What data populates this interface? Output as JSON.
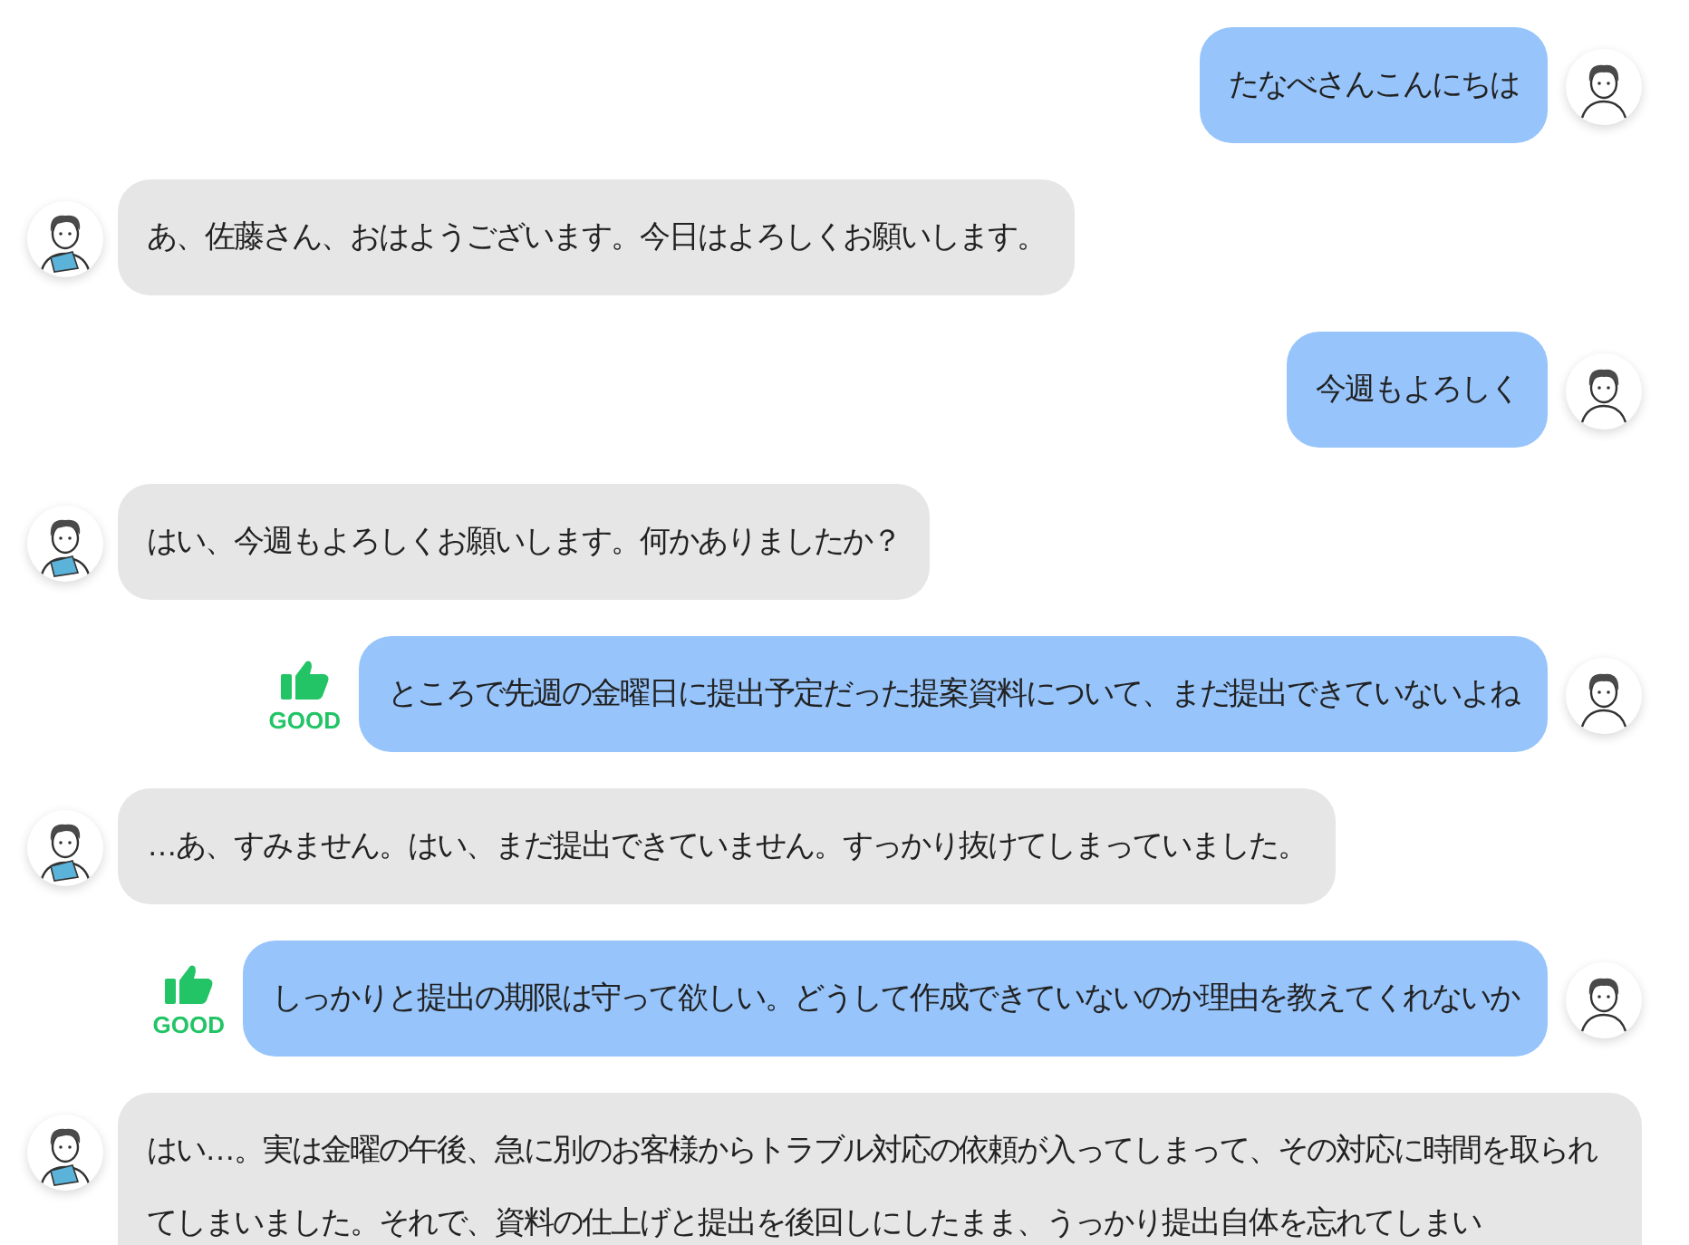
{
  "messages": [
    {
      "kind": "user",
      "text": "たなべさんこんにちは"
    },
    {
      "kind": "partner",
      "text": "あ、佐藤さん、おはようございます。今日はよろしくお願いします。"
    },
    {
      "kind": "user",
      "text": "今週もよろしく"
    },
    {
      "kind": "partner",
      "text": "はい、今週もよろしくお願いします。何かありましたか？"
    },
    {
      "kind": "user",
      "text": "ところで先週の金曜日に提出予定だった提案資料について、まだ提出できていないよね",
      "badge": "GOOD"
    },
    {
      "kind": "partner",
      "text": "…あ、すみません。はい、まだ提出できていません。すっかり抜けてしまっていました。"
    },
    {
      "kind": "user",
      "text": "しっかりと提出の期限は守って欲しい。どうして作成できていないのか理由を教えてくれないか",
      "badge": "GOOD"
    },
    {
      "kind": "partner",
      "text": "はい…。実は金曜の午後、急に別のお客様からトラブル対応の依頼が入ってしまって、その対応に時間を取られてしまいました。それで、資料の仕上げと提出を後回しにしたまま、うっかり提出自体を忘れてしまい"
    }
  ]
}
